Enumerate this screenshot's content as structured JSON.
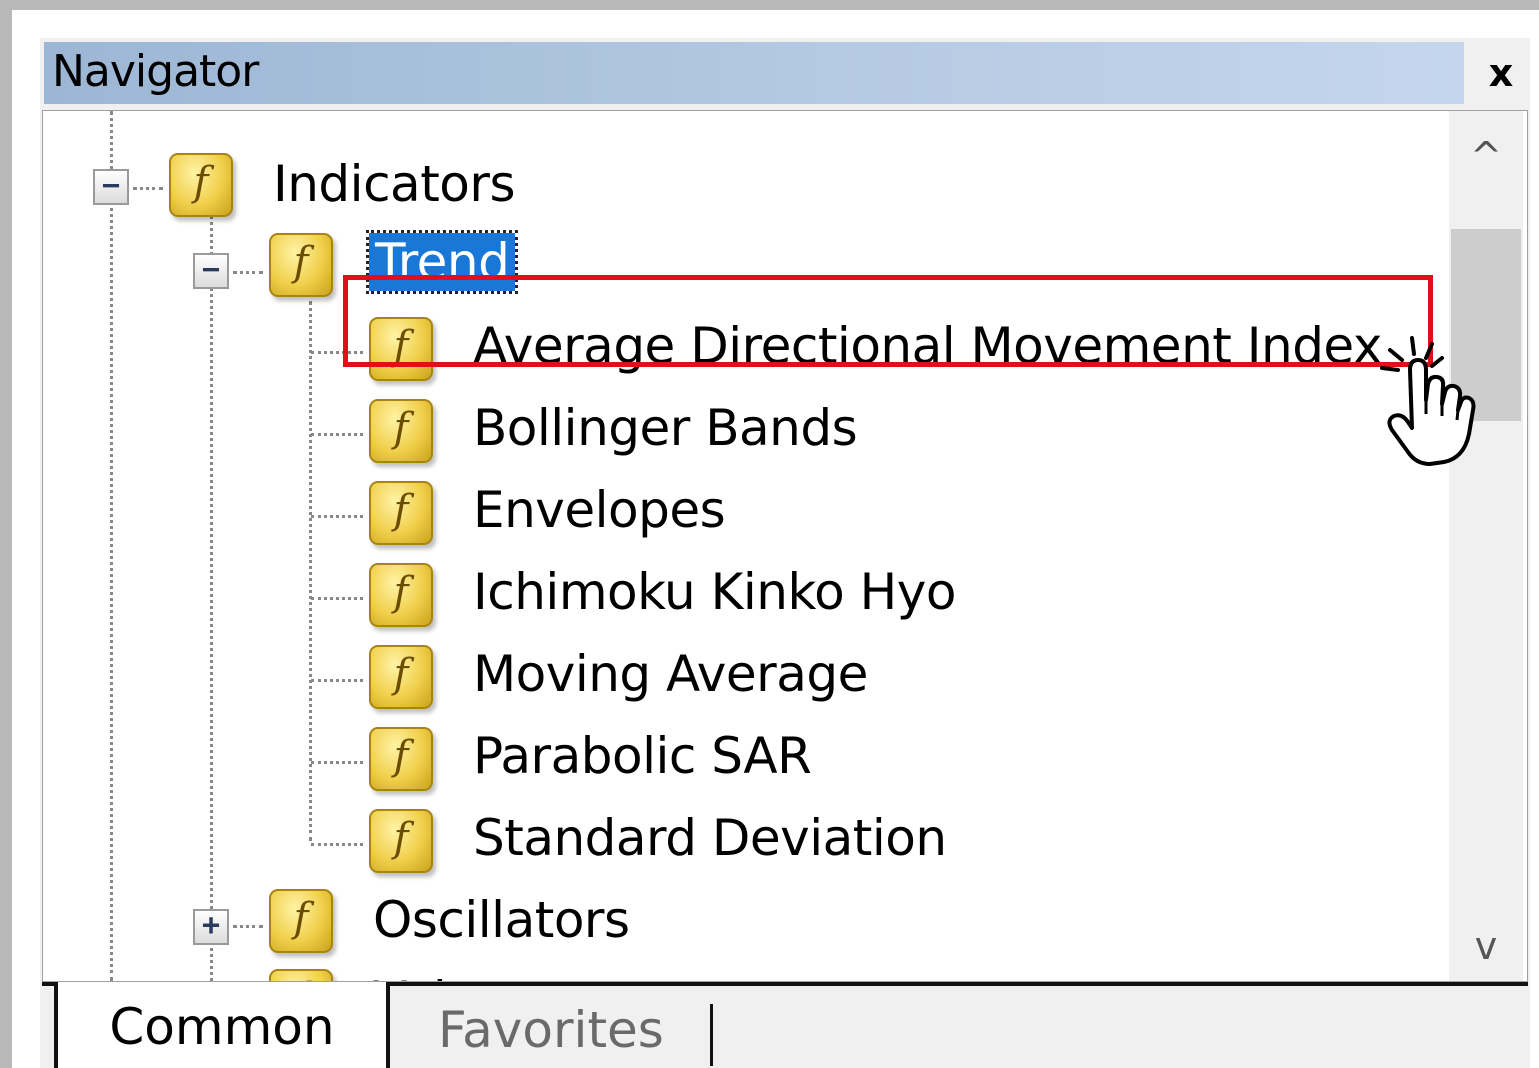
{
  "window": {
    "title": "Navigator",
    "close_label": "x"
  },
  "scrollbar": {
    "up_arrow": "^",
    "down_arrow": "v"
  },
  "tree": {
    "root": {
      "label": "Indicators",
      "expander": "−"
    },
    "trend": {
      "label": "Trend",
      "expander": "−",
      "selected": true
    },
    "trend_children": [
      "Average Directional Movement Index",
      "Bollinger Bands",
      "Envelopes",
      "Ichimoku Kinko Hyo",
      "Moving Average",
      "Parabolic SAR",
      "Standard Deviation"
    ],
    "oscillators": {
      "label": "Oscillators",
      "expander": "+"
    },
    "volumes": {
      "label": "Volumes",
      "expander": "+"
    },
    "icon_glyph": "f"
  },
  "tabs": {
    "common": "Common",
    "favorites": "Favorites",
    "active": "Common"
  },
  "colors": {
    "selection": "#1978d7",
    "highlight_box": "#e0101a",
    "icon_gold": "#f0cf4a"
  }
}
